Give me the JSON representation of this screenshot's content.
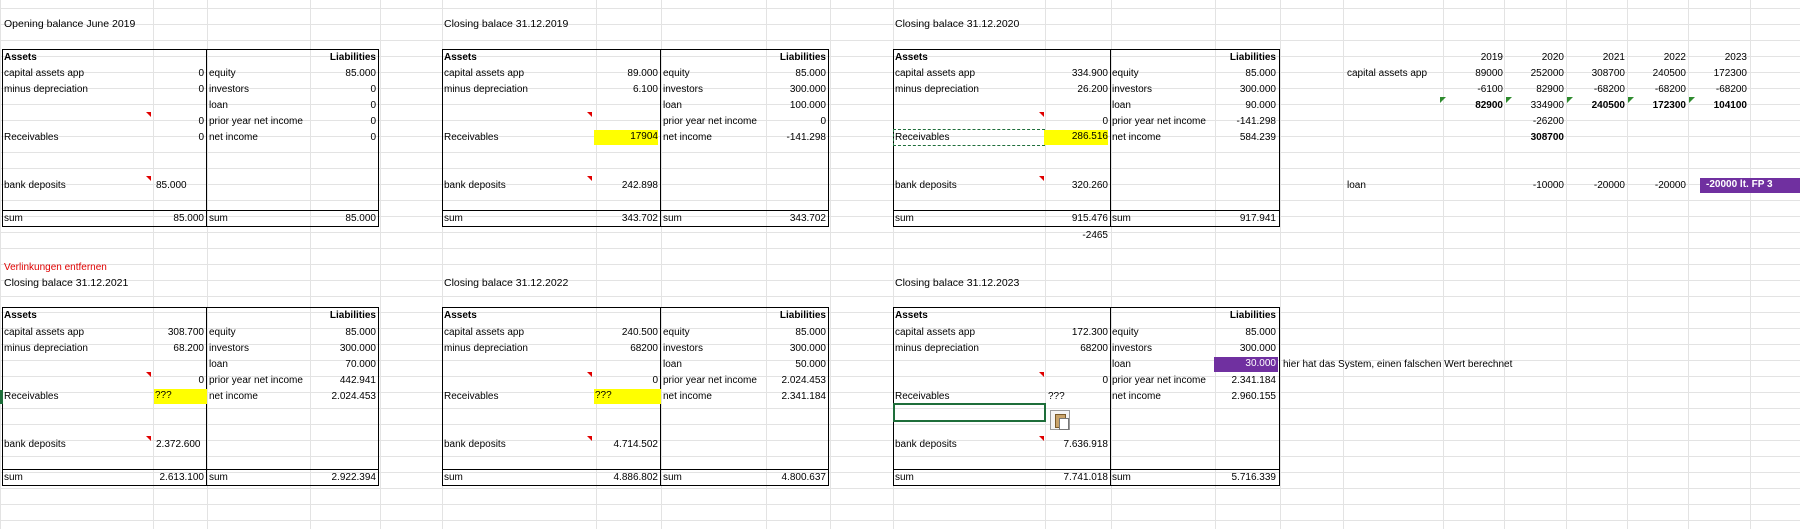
{
  "sheet": {
    "note_remove_links": "Verlinkungen entfernen",
    "system_note": "hier hat das System, einen falschen Wert berechnet"
  },
  "opening2019": {
    "title": "Opening balance June 2019",
    "assets_label": "Assets",
    "liabilities_label": "Liabilities",
    "r1_left": "capital assets app",
    "r1_val": "0",
    "r1_right": "equity",
    "r1_liab": "85.000",
    "r2_left": "minus depreciation",
    "r2_val": "0",
    "r2_right": "investors",
    "r2_liab": "0",
    "r3_right": "loan",
    "r3_liab": "0",
    "r4_val": "0",
    "r4_right": "prior year net income",
    "r4_liab": "0",
    "r5_left": "Receivables",
    "r5_val": "0",
    "r5_right": "net income",
    "r5_liab": "0",
    "r6_left": "bank deposits",
    "r6_val": "85.000",
    "sum_left": "sum",
    "sum_val": "85.000",
    "sum_right": "sum",
    "sum_liab": "85.000"
  },
  "closing2019": {
    "title": "Closing balace 31.12.2019",
    "assets_label": "Assets",
    "liabilities_label": "Liabilities",
    "r1_left": "capital assets app",
    "r1_val": "89.000",
    "r1_right": "equity",
    "r1_liab": "85.000",
    "r2_left": "minus depreciation",
    "r2_val": "6.100",
    "r2_right": "investors",
    "r2_liab": "300.000",
    "r3_right": "loan",
    "r3_liab": "100.000",
    "r4_right": "prior year net income",
    "r4_liab": "0",
    "r5_left": "Receivables",
    "r5_val": "17904",
    "r5_right": "net income",
    "r5_liab": "-141.298",
    "r6_left": "bank deposits",
    "r6_val": "242.898",
    "sum_left": "sum",
    "sum_val": "343.702",
    "sum_right": "sum",
    "sum_liab": "343.702"
  },
  "closing2020": {
    "title": "Closing balace 31.12.2020",
    "assets_label": "Assets",
    "liabilities_label": "Liabilities",
    "r1_left": "capital assets app",
    "r1_val": "334.900",
    "r1_right": "equity",
    "r1_liab": "85.000",
    "r2_left": "minus depreciation",
    "r2_val": "26.200",
    "r2_right": "investors",
    "r2_liab": "300.000",
    "r3_right": "loan",
    "r3_liab": "90.000",
    "r4_val": "0",
    "r4_right": "prior year net income",
    "r4_liab": "-141.298",
    "r5_left": "Receivables",
    "r5_val": "286.516",
    "r5_right": "net income",
    "r5_liab": "584.239",
    "r6_left": "bank deposits",
    "r6_val": "320.260",
    "sum_left": "sum",
    "sum_val": "915.476",
    "sum_right": "sum",
    "sum_liab": "917.941",
    "diff": "-2465"
  },
  "closing2021": {
    "title": "Closing balace 31.12.2021",
    "assets_label": "Assets",
    "liabilities_label": "Liabilities",
    "r1_left": "capital assets app",
    "r1_val": "308.700",
    "r1_right": "equity",
    "r1_liab": "85.000",
    "r2_left": "minus depreciation",
    "r2_val": "68.200",
    "r2_right": "investors",
    "r2_liab": "300.000",
    "r3_right": "loan",
    "r3_liab": "70.000",
    "r4_val": "0",
    "r4_right": "prior year net income",
    "r4_liab": "442.941",
    "r5_left": "Receivables",
    "r5_val": "???",
    "r5_right": "net income",
    "r5_liab": "2.024.453",
    "r6_left": "bank deposits",
    "r6_val": "2.372.600",
    "sum_left": "sum",
    "sum_val": "2.613.100",
    "sum_right": "sum",
    "sum_liab": "2.922.394"
  },
  "closing2022": {
    "title": "Closing balace 31.12.2022",
    "assets_label": "Assets",
    "liabilities_label": "Liabilities",
    "r1_left": "capital assets app",
    "r1_val": "240.500",
    "r1_right": "equity",
    "r1_liab": "85.000",
    "r2_left": "minus depreciation",
    "r2_val": "68200",
    "r2_right": "investors",
    "r2_liab": "300.000",
    "r3_right": "loan",
    "r3_liab": "50.000",
    "r4_val": "0",
    "r4_right": "prior year net income",
    "r4_liab": "2.024.453",
    "r5_left": "Receivables",
    "r5_val": "???",
    "r5_right": "net income",
    "r5_liab": "2.341.184",
    "r6_left": "bank deposits",
    "r6_val": "4.714.502",
    "sum_left": "sum",
    "sum_val": "4.886.802",
    "sum_right": "sum",
    "sum_liab": "4.800.637"
  },
  "closing2023": {
    "title": "Closing balace 31.12.2023",
    "assets_label": "Assets",
    "liabilities_label": "Liabilities",
    "r1_left": "capital assets app",
    "r1_val": "172.300",
    "r1_right": "equity",
    "r1_liab": "85.000",
    "r2_left": "minus depreciation",
    "r2_val": "68200",
    "r2_right": "investors",
    "r2_liab": "300.000",
    "r3_right": "loan",
    "r3_liab": "30.000",
    "r4_val": "0",
    "r4_right": "prior year net income",
    "r4_liab": "2.341.184",
    "r5_left": "Receivables",
    "r5_val": "???",
    "r5_right": "net income",
    "r5_liab": "2.960.155",
    "r6_left": "bank deposits",
    "r6_val": "7.636.918",
    "sum_left": "sum",
    "sum_val": "7.741.018",
    "sum_right": "sum",
    "sum_liab": "5.716.339"
  },
  "side": {
    "years": [
      "2019",
      "2020",
      "2021",
      "2022",
      "2023"
    ],
    "cap_label": "capital assets app",
    "cap_row1": [
      "89000",
      "252000",
      "308700",
      "240500",
      "172300"
    ],
    "cap_row2": [
      "-6100",
      "82900",
      "-68200",
      "-68200",
      "-68200"
    ],
    "cap_row3": [
      "82900",
      "334900",
      "240500",
      "172300",
      "104100"
    ],
    "cap_extra1": "-26200",
    "cap_extra2": "308700",
    "loan_label": "loan",
    "loan_row": [
      "-10000",
      "-20000",
      "-20000",
      "-20000 lt. FP 3"
    ]
  }
}
